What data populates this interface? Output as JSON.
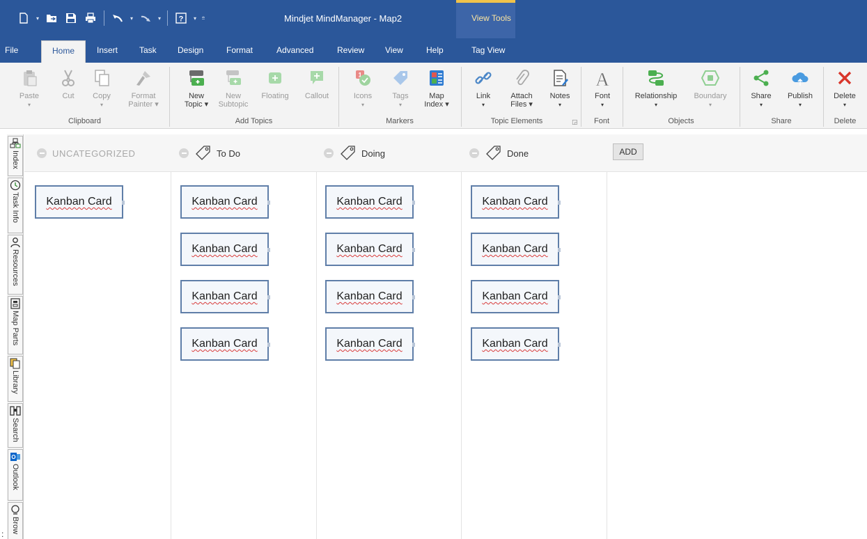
{
  "window": {
    "title": "Mindjet MindManager - Map2",
    "context_tab_group": "View Tools"
  },
  "tabs": [
    {
      "label": "File"
    },
    {
      "label": "Home"
    },
    {
      "label": "Insert"
    },
    {
      "label": "Task"
    },
    {
      "label": "Design"
    },
    {
      "label": "Format"
    },
    {
      "label": "Advanced"
    },
    {
      "label": "Review"
    },
    {
      "label": "View"
    },
    {
      "label": "Help"
    },
    {
      "label": "Tag View"
    }
  ],
  "active_tab": "Home",
  "ribbon": {
    "clipboard": {
      "label": "Clipboard",
      "paste": "Paste",
      "cut": "Cut",
      "copy": "Copy",
      "format_painter_1": "Format",
      "format_painter_2": "Painter"
    },
    "add_topics": {
      "label": "Add Topics",
      "new_topic_1": "New",
      "new_topic_2": "Topic",
      "new_subtopic_1": "New",
      "new_subtopic_2": "Subtopic",
      "floating": "Floating",
      "callout": "Callout"
    },
    "markers": {
      "label": "Markers",
      "icons": "Icons",
      "tags": "Tags",
      "map_index_1": "Map",
      "map_index_2": "Index"
    },
    "topic_elements": {
      "label": "Topic Elements",
      "link": "Link",
      "attach_files_1": "Attach",
      "attach_files_2": "Files",
      "notes": "Notes"
    },
    "font": {
      "label": "Font",
      "font": "Font"
    },
    "objects": {
      "label": "Objects",
      "relationship": "Relationship",
      "boundary": "Boundary"
    },
    "share": {
      "label": "Share",
      "share": "Share",
      "publish": "Publish"
    },
    "delete": {
      "label": "Delete",
      "delete": "Delete"
    }
  },
  "side_panel": [
    {
      "label": "Index",
      "icon": "index-icon"
    },
    {
      "label": "Task Info",
      "icon": "clock-icon"
    },
    {
      "label": "Resources",
      "icon": "person-icon"
    },
    {
      "label": "Map Parts",
      "icon": "map-parts-icon"
    },
    {
      "label": "Library",
      "icon": "library-icon"
    },
    {
      "label": "Search",
      "icon": "binoculars-icon"
    },
    {
      "label": "Outlook",
      "icon": "outlook-icon"
    },
    {
      "label": "Brow",
      "icon": "browser-icon"
    }
  ],
  "kanban": {
    "add_label": "ADD",
    "columns": [
      {
        "title": "UNCATEGORIZED",
        "cards": [
          "Kanban Card"
        ]
      },
      {
        "title": "To Do",
        "cards": [
          "Kanban Card",
          "Kanban Card",
          "Kanban Card",
          "Kanban Card"
        ]
      },
      {
        "title": "Doing",
        "cards": [
          "Kanban Card",
          "Kanban Card",
          "Kanban Card",
          "Kanban Card"
        ]
      },
      {
        "title": "Done",
        "cards": [
          "Kanban Card",
          "Kanban Card",
          "Kanban Card",
          "Kanban Card"
        ]
      }
    ]
  },
  "stray_mark": ":",
  "colors": {
    "title_bar": "#2b579a",
    "context_accent": "#f0c24a",
    "card_border": "#5f7ea8",
    "delete_red": "#d9362b",
    "objects_green": "#4caf50"
  }
}
